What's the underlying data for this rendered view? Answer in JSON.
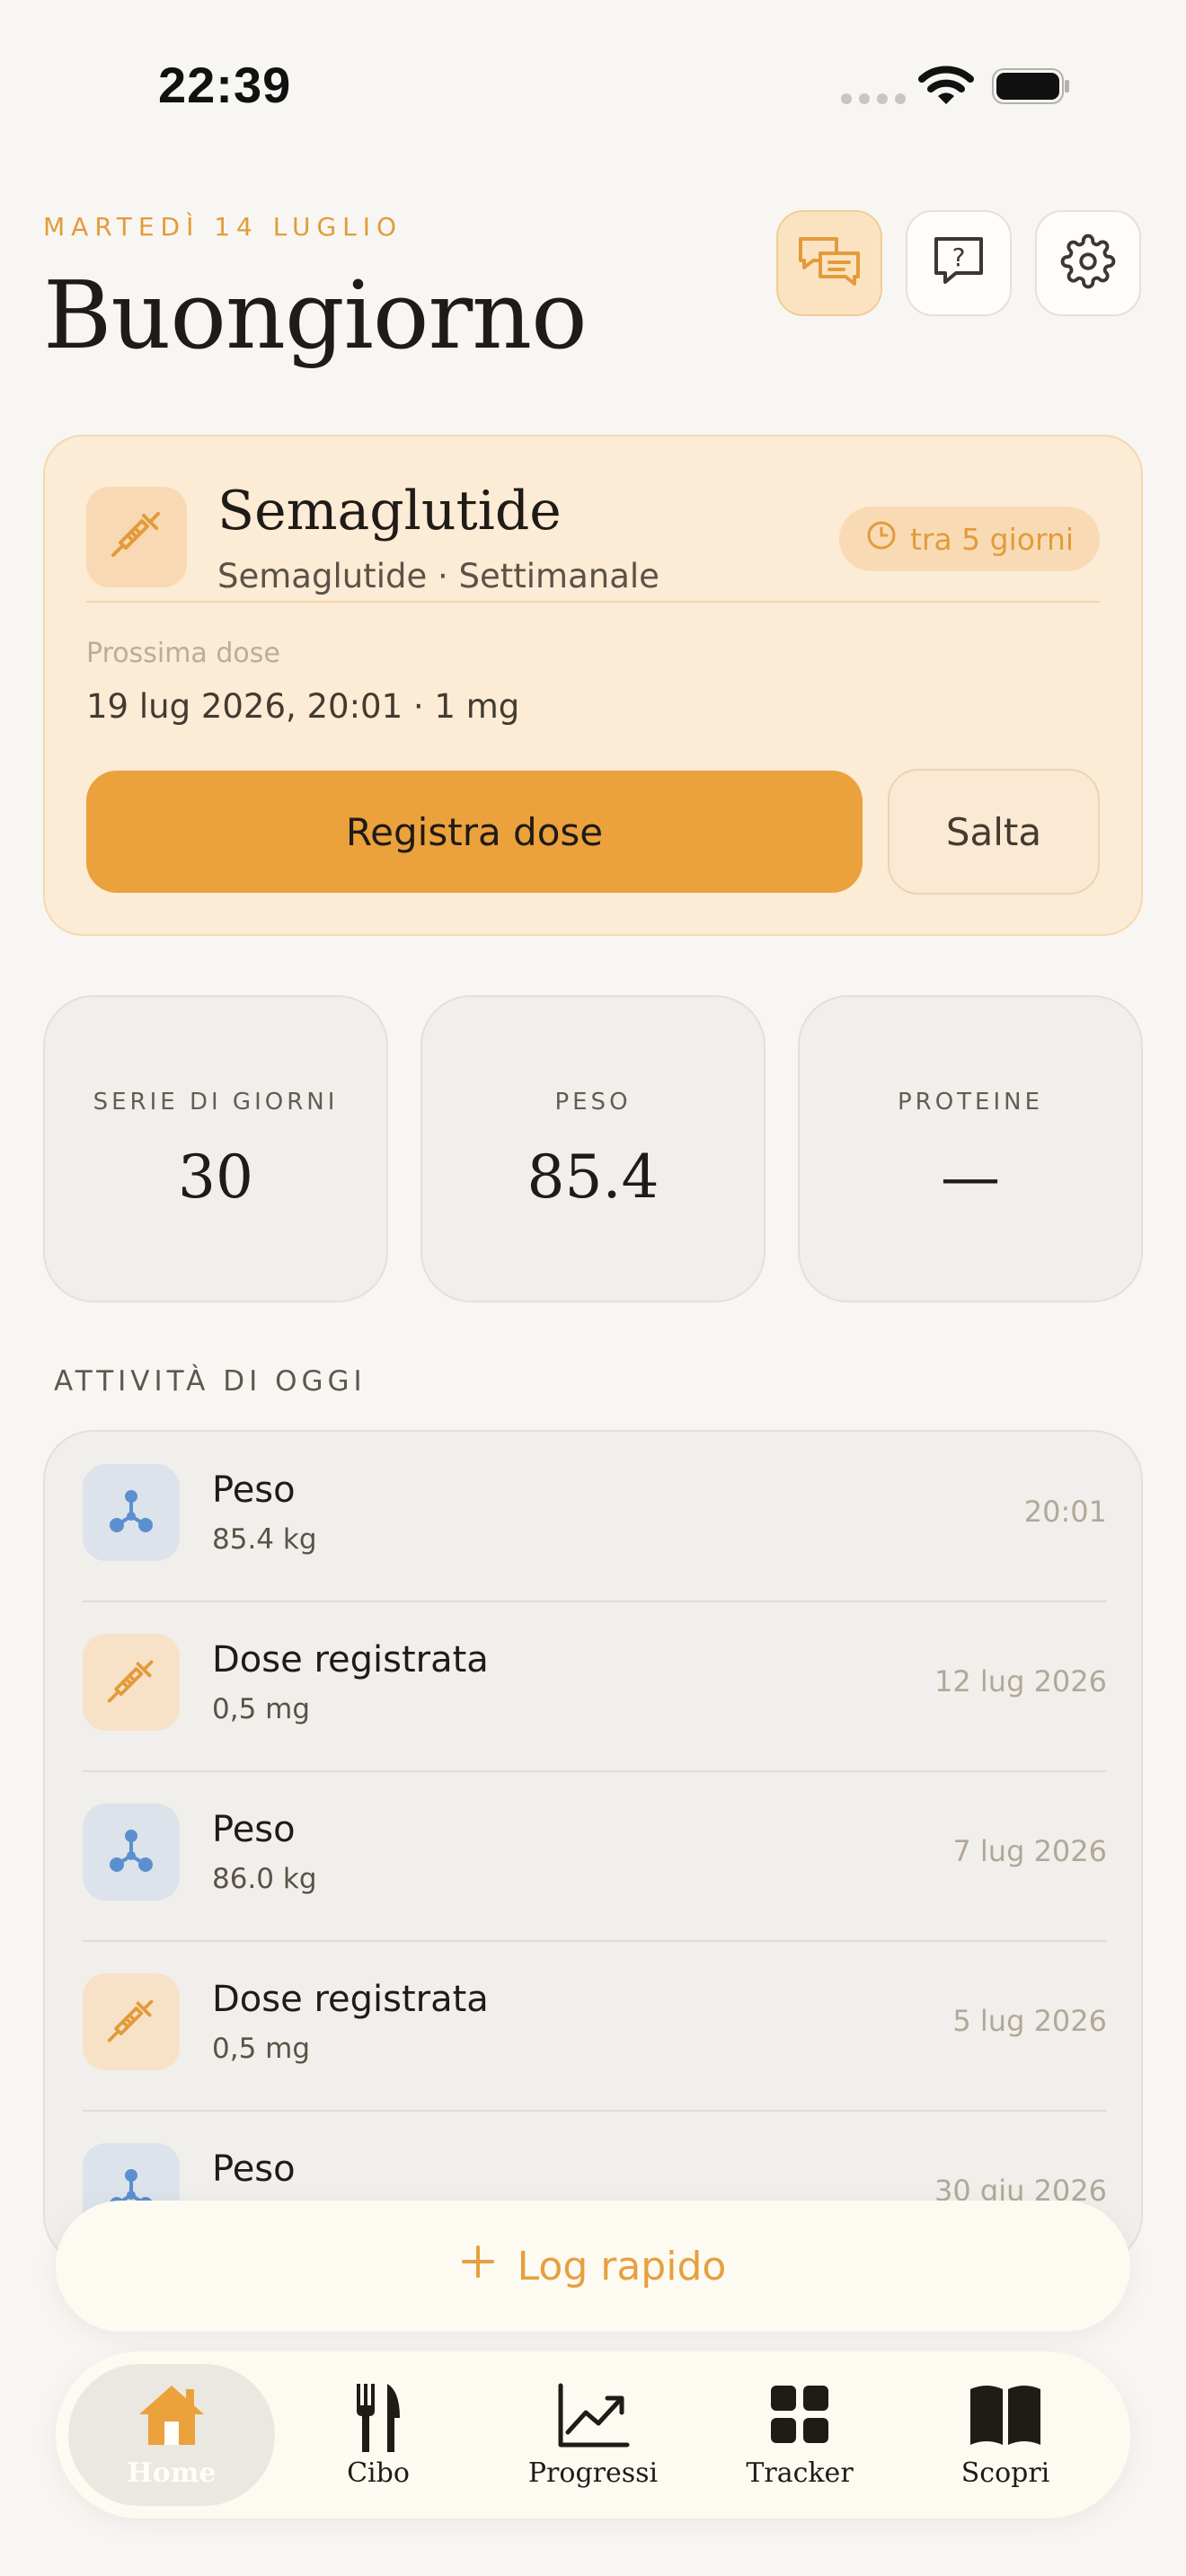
{
  "status_bar": {
    "time": "22:39"
  },
  "header": {
    "date": "MARTEDÌ 14 LUGLIO",
    "greeting": "Buongiorno",
    "buttons": {
      "chat_icon": "chat-bubbles-icon",
      "help_icon": "help-icon",
      "settings_icon": "gear-icon"
    }
  },
  "medication": {
    "name": "Semaglutide",
    "subtitle": "Semaglutide · Settimanale",
    "badge": "tra 5 giorni",
    "next_label": "Prossima dose",
    "next_value": "19 lug 2026, 20:01 · 1 mg",
    "primary_button": "Registra dose",
    "skip_button": "Salta",
    "icon": "syringe-icon"
  },
  "stats": [
    {
      "label": "SERIE DI GIORNI",
      "value": "30"
    },
    {
      "label": "PESO",
      "value": "85.4"
    },
    {
      "label": "PROTEINE",
      "value": "—"
    }
  ],
  "activity": {
    "title": "ATTIVITÀ DI OGGI",
    "items": [
      {
        "title": "Peso",
        "detail": "85.4 kg",
        "date": "20:01",
        "icon": "weight-nodes-icon"
      },
      {
        "title": "Dose registrata",
        "detail": "0,5 mg",
        "date": "12 lug 2026",
        "icon": "syringe-icon"
      },
      {
        "title": "Peso",
        "detail": "86.0 kg",
        "date": "7 lug 2026",
        "icon": "weight-nodes-icon"
      },
      {
        "title": "Dose registrata",
        "detail": "0,5 mg",
        "date": "5 lug 2026",
        "icon": "syringe-icon"
      },
      {
        "title": "Peso",
        "detail": "",
        "date": "30 giu 2026",
        "icon": "weight-nodes-icon"
      }
    ]
  },
  "quick_log": {
    "label": "Log rapido"
  },
  "tabs": [
    {
      "label": "Home",
      "icon": "home-icon",
      "active": true
    },
    {
      "label": "Cibo",
      "icon": "fork-knife-icon"
    },
    {
      "label": "Progressi",
      "icon": "chart-trend-icon"
    },
    {
      "label": "Tracker",
      "icon": "grid-icon"
    },
    {
      "label": "Scopri",
      "icon": "book-icon"
    }
  ],
  "colors": {
    "accent": "#eba13c",
    "accent_text": "#e39b3a",
    "background": "#f8f6f2",
    "blue_icon": "#5b8fd0"
  }
}
